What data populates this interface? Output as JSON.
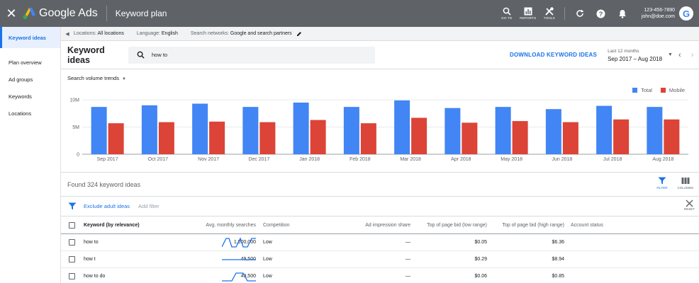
{
  "app": {
    "logo_text": "Google Ads",
    "title": "Keyword plan"
  },
  "top_tools": [
    {
      "label": "GO TO",
      "icon": "search-icon"
    },
    {
      "label": "REPORTS",
      "icon": "reports-icon"
    },
    {
      "label": "TOOLS",
      "icon": "tools-icon"
    }
  ],
  "account": {
    "phone": "123-456-7890",
    "email": "john@doe.com",
    "avatar_letter": "G"
  },
  "sidebar": {
    "items": [
      {
        "label": "Keyword ideas",
        "active": true
      },
      {
        "label": "Plan overview"
      },
      {
        "label": "Ad groups"
      },
      {
        "label": "Keywords"
      },
      {
        "label": "Locations"
      }
    ]
  },
  "filterbar": {
    "locations_label": "Locations:",
    "locations_value": "All locations",
    "language_label": "Language:",
    "language_value": "English",
    "networks_label": "Search networks:",
    "networks_value": "Google and search partners"
  },
  "header": {
    "title": "Keyword ideas",
    "search_value": "how to",
    "download_label": "DOWNLOAD KEYWORD IDEAS",
    "date_caption": "Last 12 months",
    "date_range": "Sep 2017 – Aug 2018"
  },
  "chart_select": "Search volume trends",
  "colors": {
    "total": "#4285f4",
    "mobile": "#db4437",
    "accent": "#1a73e8"
  },
  "chart_data": {
    "type": "bar",
    "categories": [
      "Sep 2017",
      "Oct 2017",
      "Nov 2017",
      "Dec 2017",
      "Jan 2018",
      "Feb 2018",
      "Mar 2018",
      "Apr 2018",
      "May 2018",
      "Jun 2018",
      "Jul 2018",
      "Aug 2018"
    ],
    "series": [
      {
        "name": "Total",
        "values": [
          8.7,
          9.0,
          9.3,
          8.7,
          9.5,
          8.7,
          9.9,
          8.5,
          8.7,
          8.3,
          8.9,
          8.7
        ]
      },
      {
        "name": "Mobile",
        "values": [
          5.7,
          5.9,
          6.0,
          5.9,
          6.3,
          5.7,
          6.7,
          5.8,
          6.1,
          5.9,
          6.4,
          6.4
        ]
      }
    ],
    "yticks": [
      "0",
      "5M",
      "10M"
    ],
    "ylim": [
      0,
      10.8
    ],
    "grid": true,
    "legend": "top-right"
  },
  "results": {
    "found_text": "Found 324 keyword ideas",
    "filter_label": "FILTER",
    "columns_label": "COLUMNS",
    "exclude_label": "Exclude adult ideas",
    "add_filter_label": "Add filter",
    "reset_label": "RESET"
  },
  "table": {
    "headers": {
      "keyword": "Keyword (by relevance)",
      "avg": "Avg. monthly searches",
      "competition": "Competition",
      "share": "Ad impression share",
      "low": "Top of page bid (low range)",
      "high": "Top of page bid (high range)",
      "status": "Account status"
    },
    "rows": [
      {
        "keyword": "how to",
        "avg": "1,000,000",
        "competition": "Low",
        "share": "—",
        "low": "$0.05",
        "high": "$6.36"
      },
      {
        "keyword": "how t",
        "avg": "49,500",
        "competition": "Low",
        "share": "—",
        "low": "$0.29",
        "high": "$8.94"
      },
      {
        "keyword": "how to do",
        "avg": "49,500",
        "competition": "Low",
        "share": "—",
        "low": "$0.06",
        "high": "$0.85"
      }
    ]
  }
}
